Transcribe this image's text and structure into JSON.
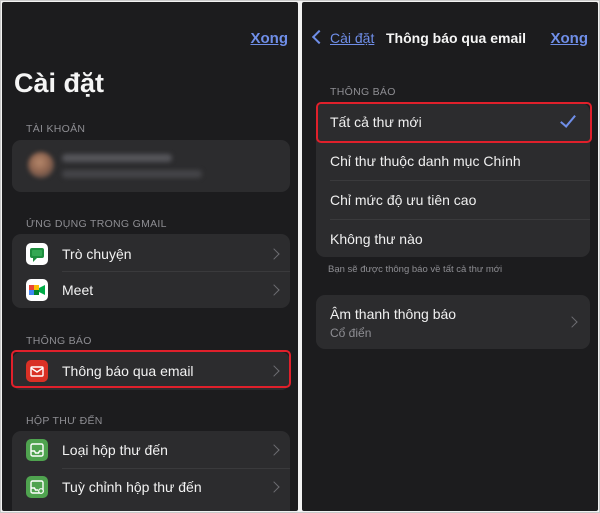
{
  "left": {
    "done_label": "Xong",
    "title": "Cài đặt",
    "account_section": "TÀI KHOẢN",
    "apps_section": "ỨNG DỤNG TRONG GMAIL",
    "apps": [
      {
        "label": "Trò chuyện",
        "icon": "chat-icon"
      },
      {
        "label": "Meet",
        "icon": "meet-icon"
      }
    ],
    "notify_section": "THÔNG BÁO",
    "notify_item": {
      "label": "Thông báo qua email",
      "icon": "mail-icon"
    },
    "inbox_section": "HỘP THƯ ĐẾN",
    "inbox_items": [
      {
        "label": "Loại hộp thư đến",
        "icon": "inbox-icon"
      },
      {
        "label": "Tuỳ chỉnh hộp thư đến",
        "icon": "inbox-settings-icon"
      }
    ]
  },
  "right": {
    "back_label": "Cài đặt",
    "title": "Thông báo qua email",
    "done_label": "Xong",
    "section": "THÔNG BÁO",
    "options": [
      {
        "label": "Tất cả thư mới",
        "selected": true
      },
      {
        "label": "Chỉ thư thuộc danh mục Chính",
        "selected": false
      },
      {
        "label": "Chỉ mức độ ưu tiên cao",
        "selected": false
      },
      {
        "label": "Không thư nào",
        "selected": false
      }
    ],
    "footnote": "Bạn sẽ được thông báo về tất cả thư mới",
    "sound": {
      "title": "Âm thanh thông báo",
      "value": "Cổ điển"
    }
  },
  "colors": {
    "accent": "#6f8ee8",
    "highlight": "#e0202b",
    "panel": "#1c1c1e",
    "card": "#2c2c2e"
  }
}
